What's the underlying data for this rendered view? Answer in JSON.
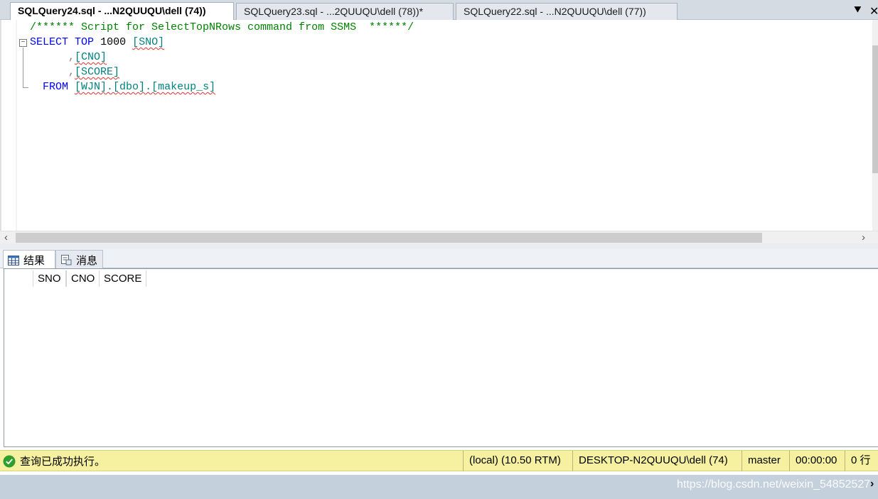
{
  "tabs": [
    {
      "label": "SQLQuery24.sql - ...N2QUUQU\\dell (74))",
      "active": true
    },
    {
      "label": "SQLQuery23.sql - ...2QUUQU\\dell (78))*",
      "active": false
    },
    {
      "label": "SQLQuery22.sql - ...N2QUUQU\\dell (77))",
      "active": false
    }
  ],
  "editor": {
    "comment": "/****** Script for SelectTopNRows command from SSMS  ******/",
    "kw_select": "SELECT",
    "kw_top": "TOP",
    "top_n": "1000",
    "col_sno": "[SNO]",
    "comma": ",",
    "col_cno": "[CNO]",
    "col_score": "[SCORE]",
    "kw_from": "FROM",
    "table": "[WJN].[dbo].[makeup_s]"
  },
  "results": {
    "tab_results": "结果",
    "tab_messages": "消息",
    "columns": [
      "SNO",
      "CNO",
      "SCORE"
    ]
  },
  "status": {
    "message": "查询已成功执行。",
    "server": "(local) (10.50 RTM)",
    "user": "DESKTOP-N2QUUQU\\dell (74)",
    "database": "master",
    "elapsed": "00:00:00",
    "rows": "0 行"
  },
  "watermark": "https://blog.csdn.net/weixin_54852527",
  "colors": {
    "keyword": "#0000ff",
    "comment": "#008000",
    "identifier": "#008080",
    "status_bg": "#f6f1a1"
  },
  "icons": {
    "tab_menu": "dropdown-icon",
    "tab_close": "close-icon",
    "results_tab": "grid-icon",
    "messages_tab": "message-icon",
    "status_ok": "check-circle-icon"
  }
}
